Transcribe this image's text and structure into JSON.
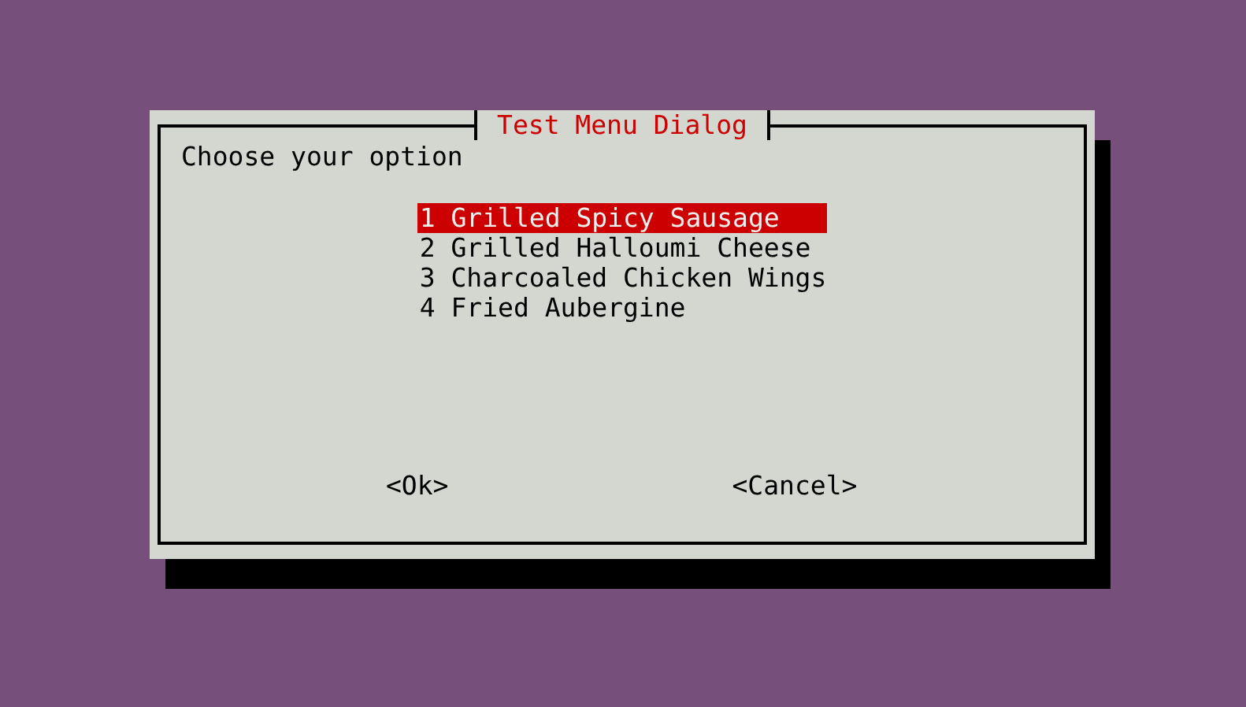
{
  "dialog": {
    "title": "Test Menu Dialog",
    "prompt": "Choose your option",
    "items": [
      {
        "label": "1 Grilled Spicy Sausage",
        "selected": true
      },
      {
        "label": "2 Grilled Halloumi Cheese",
        "selected": false
      },
      {
        "label": "3 Charcoaled Chicken Wings",
        "selected": false
      },
      {
        "label": "4 Fried Aubergine",
        "selected": false
      }
    ],
    "buttons": [
      "<Ok>",
      "<Cancel>"
    ]
  }
}
